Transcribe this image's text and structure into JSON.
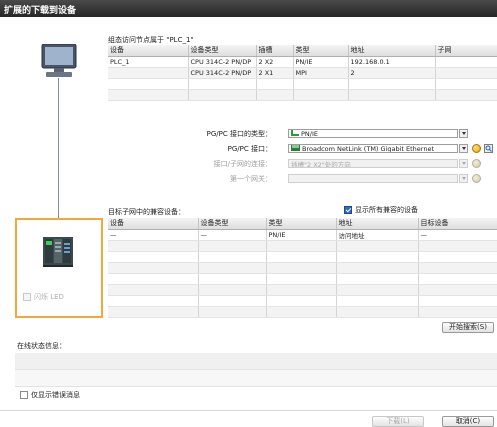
{
  "window": {
    "title": "扩展的下载到设备"
  },
  "config_table": {
    "caption": "组态访问节点属于 \"PLC_1\"",
    "columns": [
      "设备",
      "设备类型",
      "插槽",
      "类型",
      "地址",
      "子网"
    ],
    "rows": [
      [
        "PLC_1",
        "CPU 314C-2 PN/DP",
        "2 X2",
        "PN/IE",
        "192.168.0.1",
        ""
      ],
      [
        "",
        "CPU 314C-2 PN/DP",
        "2 X1",
        "MPI",
        "2",
        ""
      ],
      [
        "",
        "",
        "",
        "",
        "",
        ""
      ],
      [
        "",
        "",
        "",
        "",
        "",
        ""
      ]
    ]
  },
  "pc_panel": {
    "icon": "pc-monitor-icon"
  },
  "interface_settings": {
    "type_label": "PG/PC 接口的类型：",
    "type_value": "PN/IE",
    "interface_label": "PG/PC 接口：",
    "interface_value": "Broadcom NetLink (TM) Gigabit Ethernet",
    "subnet_conn_label": "接口/子网的连接：",
    "subnet_conn_value": "插槽\"2 X2\"处的方向",
    "gateway_label": "第一个网关：",
    "gateway_value": ""
  },
  "target_table": {
    "caption": "目标子网中的兼容设备：",
    "show_all_label": "显示所有兼容的设备",
    "show_all_checked": true,
    "columns": [
      "设备",
      "设备类型",
      "类型",
      "地址",
      "目标设备"
    ],
    "rows": [
      [
        "—",
        "—",
        "PN/IE",
        "访问地址",
        "—"
      ],
      [
        "",
        "",
        "",
        "",
        ""
      ],
      [
        "",
        "",
        "",
        "",
        ""
      ],
      [
        "",
        "",
        "",
        "",
        ""
      ],
      [
        "",
        "",
        "",
        "",
        ""
      ],
      [
        "",
        "",
        "",
        "",
        ""
      ],
      [
        "",
        "",
        "",
        "",
        ""
      ],
      [
        "",
        "",
        "",
        "",
        ""
      ]
    ]
  },
  "device_panel": {
    "icon": "plc-device-icon",
    "flash_led_label": "闪烁 LED"
  },
  "buttons": {
    "start_search": "开始搜索(S)",
    "load": "下载(L)",
    "cancel": "取消(C)"
  },
  "status": {
    "caption": "在线状态信息：",
    "error_only_label": "仅显示错误消息"
  },
  "colors": {
    "accent": "#f2a93b",
    "title_bar": "#333333",
    "pn_green": "#2e9b3a"
  }
}
